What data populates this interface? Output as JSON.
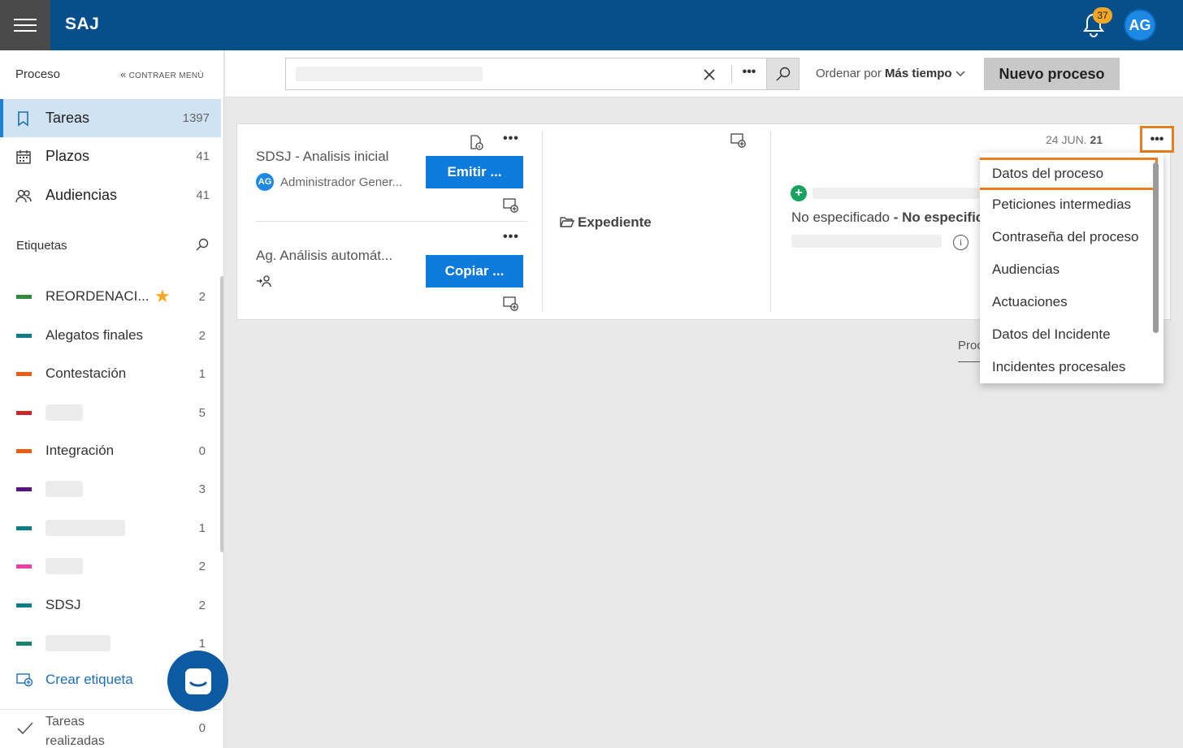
{
  "app": {
    "brand": "SAJ",
    "notifications_count": "37",
    "user_initials": "AG"
  },
  "sidebar": {
    "header": "Proceso",
    "collapse_label": "CONTRAER MENÚ",
    "nav": [
      {
        "label": "Tareas",
        "count": "1397",
        "icon": "book-icon"
      },
      {
        "label": "Plazos",
        "count": "41",
        "icon": "calendar-icon"
      },
      {
        "label": "Audiencias",
        "count": "41",
        "icon": "people-icon"
      }
    ],
    "tags_header": "Etiquetas",
    "tags": [
      {
        "label": "REORDENACI...",
        "count": "2",
        "color": "#2e8b3e",
        "starred": true
      },
      {
        "label": "Alegatos finales",
        "count": "2",
        "color": "#0e7c86"
      },
      {
        "label": "Contestación",
        "count": "1",
        "color": "#e8600f"
      },
      {
        "label": "",
        "count": "5",
        "color": "#c62828"
      },
      {
        "label": "Integración",
        "count": "0",
        "color": "#e8600f"
      },
      {
        "label": "",
        "count": "3",
        "color": "#5b1280"
      },
      {
        "label": "",
        "count": "1",
        "color": "#0e7c86"
      },
      {
        "label": "",
        "count": "2",
        "color": "#e83fa8"
      },
      {
        "label": "SDSJ",
        "count": "2",
        "color": "#0e7c86"
      },
      {
        "label": "",
        "count": "1",
        "color": "#13856f"
      }
    ],
    "create_tag_label": "Crear etiqueta",
    "done_label": "Tareas realizadas",
    "done_count": "0"
  },
  "toolbar": {
    "search_placeholder": "",
    "sort_prefix": "Ordenar por",
    "sort_value": "Más tiempo",
    "new_process_label": "Nuevo proceso"
  },
  "card": {
    "task1": {
      "title": "SDSJ - Analisis inicial",
      "assignee": "Administrador Gener...",
      "assignee_initials": "AG",
      "button": "Emitir ..."
    },
    "task2": {
      "title": "Ag. Análisis automát...",
      "button": "Copiar ..."
    },
    "expediente_label": "Expediente",
    "date_prefix": "24 JUN.",
    "date_day": "21",
    "no_especificado": "No especificado",
    "no_especificado_2": "No especific",
    "proc_tab": "Proc"
  },
  "menu": {
    "items": [
      "Datos del proceso",
      "Peticiones intermedias",
      "Contraseña del proceso",
      "Audiencias",
      "Actuaciones",
      "Datos del Incidente",
      "Incidentes procesales"
    ]
  },
  "colors": {
    "topbar": "#064f8b",
    "accent": "#0c7bdc",
    "highlight": "#e87e1c"
  }
}
